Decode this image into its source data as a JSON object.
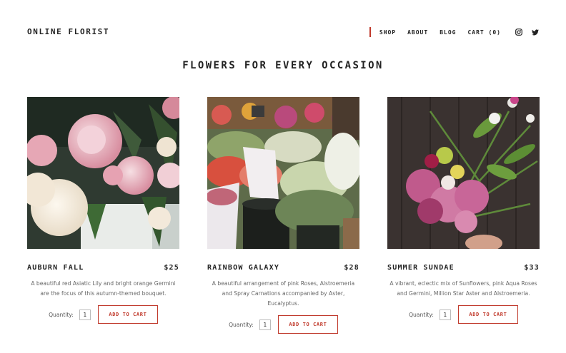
{
  "header": {
    "brand": "ONLINE FLORIST",
    "nav": [
      {
        "label": "SHOP"
      },
      {
        "label": "ABOUT"
      },
      {
        "label": "BLOG"
      },
      {
        "label": "CART (0)"
      }
    ],
    "social": [
      "instagram-icon",
      "twitter-icon"
    ]
  },
  "main": {
    "title": "FLOWERS FOR EVERY OCCASION",
    "products": [
      {
        "name": "AUBURN FALL",
        "price": "$25",
        "description": "A beautiful red Asiatic Lily and bright orange Germini are the focus of this autumn-themed bouquet.",
        "quantity_label": "Quantity:",
        "quantity": "1",
        "button": "ADD TO CART"
      },
      {
        "name": "RAINBOW GALAXY",
        "price": "$28",
        "description": "A beautiful arrangement of pink Roses, Alstroemeria and Spray Carnations accompanied by Aster, Eucalyptus.",
        "quantity_label": "Quantity:",
        "quantity": "1",
        "button": "ADD TO CART"
      },
      {
        "name": "SUMMER SUNDAE",
        "price": "$33",
        "description": "A vibrant, eclectic mix of Sunflowers, pink Aqua Roses and Germini,  Million Star Aster and Alstroemeria.",
        "quantity_label": "Quantity:",
        "quantity": "1",
        "button": "ADD TO CART"
      }
    ]
  },
  "colors": {
    "accent": "#c0392b",
    "text": "#222222",
    "muted": "#666666"
  }
}
